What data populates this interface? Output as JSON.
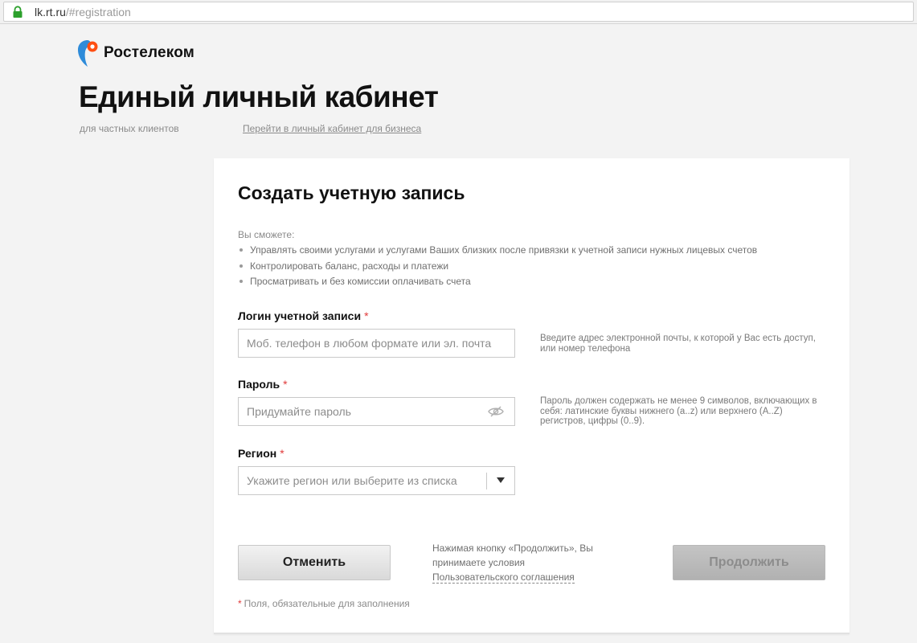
{
  "browser": {
    "url_host": "lk.rt.ru",
    "url_path": "/#registration"
  },
  "header": {
    "brand": "Ростелеком",
    "title": "Единый личный кабинет",
    "subtitle": "для частных клиентов",
    "business_link": "Перейти в личный кабинет для бизнеса"
  },
  "form": {
    "title": "Создать учетную запись",
    "benefits_intro": "Вы сможете:",
    "benefits": [
      "Управлять своими услугами и услугами Ваших близких после привязки к учетной записи нужных лицевых счетов",
      "Контролировать баланс, расходы и платежи",
      "Просматривать и без комиссии оплачивать счета"
    ],
    "required_mark": "*",
    "login": {
      "label": "Логин учетной записи",
      "placeholder": "Моб. телефон в любом формате или эл. почта",
      "hint": "Введите адрес электронной почты, к которой у Вас есть доступ, или номер телефона"
    },
    "password": {
      "label": "Пароль",
      "placeholder": "Придумайте пароль",
      "hint": "Пароль должен содержать не менее 9 символов, включающих в себя: латинские буквы нижнего (a..z) или верхнего (A..Z) регистров, цифры (0..9)."
    },
    "region": {
      "label": "Регион",
      "placeholder": "Укажите регион или выберите из списка"
    },
    "cancel_label": "Отменить",
    "continue_label": "Продолжить",
    "agreement_text": "Нажимая кнопку «Продолжить», Вы принимаете условия",
    "agreement_link": "Пользовательского соглашения",
    "required_note": "Поля, обязательные для заполнения"
  },
  "colors": {
    "brand_orange": "#ff4f12",
    "brand_blue": "#2e8bd9",
    "required_red": "#e03a3a"
  }
}
